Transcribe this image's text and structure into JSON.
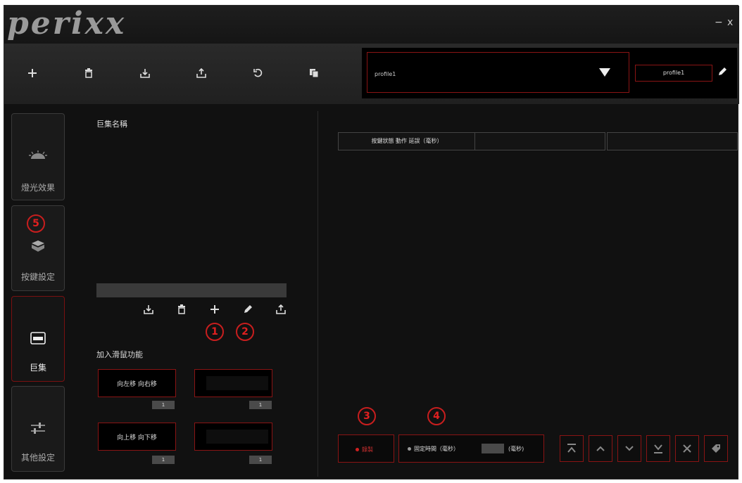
{
  "app": {
    "logo": "perixx",
    "minimize": "−",
    "close": "x"
  },
  "toolbar": {
    "icons": [
      "plus-icon",
      "trash-icon",
      "import-icon",
      "export-icon",
      "undo-icon",
      "copy-icon"
    ],
    "profile_select": "profile1",
    "profile_name": "profile1"
  },
  "sidebar": {
    "items": [
      {
        "label": "燈光效果",
        "icon": "light-icon"
      },
      {
        "label": "按鍵設定",
        "icon": "key-icon"
      },
      {
        "label": "巨集",
        "icon": "macro-icon"
      },
      {
        "label": "其他設定",
        "icon": "sliders-icon"
      }
    ]
  },
  "macro": {
    "title": "巨集名稱",
    "icons": [
      "import-icon",
      "trash-icon",
      "plus-icon",
      "pencil-icon",
      "export-icon"
    ],
    "mouse_title": "加入滑鼠功能",
    "move_lr": "向左移 向右移",
    "move_ud": "向上移 向下移",
    "counters": [
      "1",
      "1",
      "1",
      "1"
    ]
  },
  "grid": {
    "headers": [
      "按鍵狀態 動作 延誤（毫秒）",
      "",
      ""
    ]
  },
  "bottom": {
    "record_label": "錄製",
    "fixed_time_label": "固定時間（毫秒）",
    "ms_label": "(毫秒)"
  },
  "callouts": [
    "1",
    "2",
    "3",
    "4",
    "5"
  ],
  "colors": {
    "accent": "#8a1414",
    "callout": "#c81e1e",
    "background": "#111111"
  }
}
